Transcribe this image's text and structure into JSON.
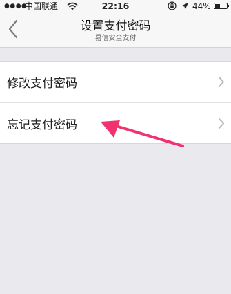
{
  "status_bar": {
    "signal": "●●●●○",
    "carrier": "中国联通",
    "wifi_icon": "wifi-icon",
    "time": "22:16",
    "lock_icon": "rotation-lock-icon",
    "location_icon": "location-arrow-icon",
    "battery_percent": "44%",
    "battery_level": 0.44
  },
  "header": {
    "title": "设置支付密码",
    "subtitle": "易信安全支付",
    "back_icon": "chevron-left-icon"
  },
  "menu": {
    "items": [
      {
        "label": "修改支付密码",
        "icon": "chevron-right-icon"
      },
      {
        "label": "忘记支付密码",
        "icon": "chevron-right-icon"
      }
    ]
  },
  "annotation": {
    "arrow_color": "#f0326e"
  },
  "colors": {
    "background": "#e9e9ee",
    "nav_background": "#f7f7f8",
    "chevron": "#b8b8be"
  }
}
